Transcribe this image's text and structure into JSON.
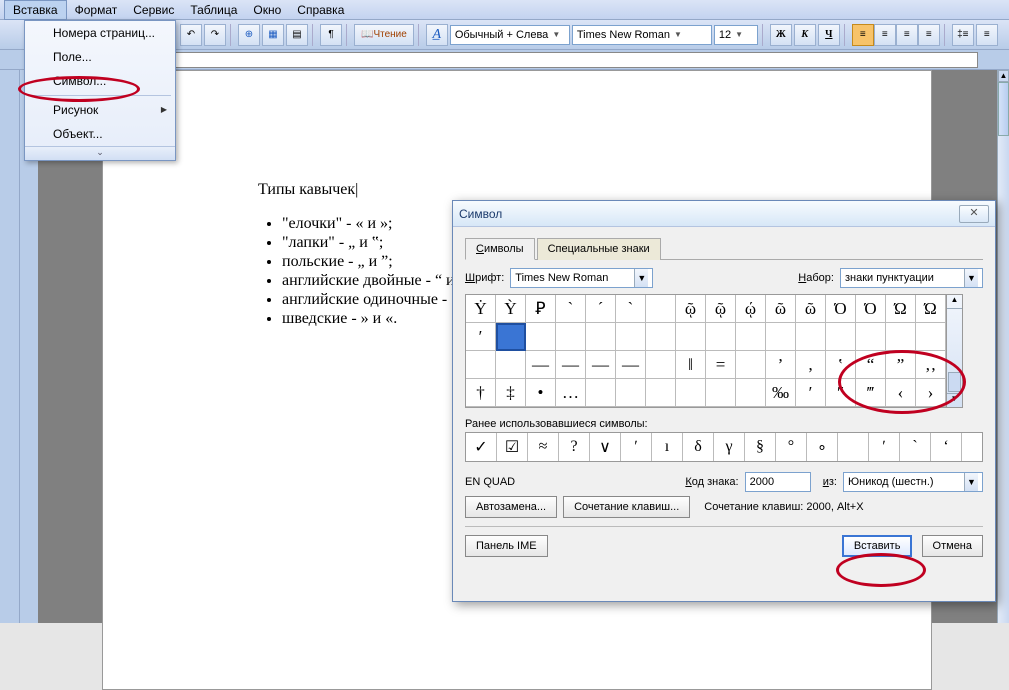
{
  "menubar": [
    "Вставка",
    "Формат",
    "Сервис",
    "Таблица",
    "Окно",
    "Справка"
  ],
  "menubar_u": [
    "В",
    "Ф",
    "С",
    "Т",
    "О",
    "С"
  ],
  "toolbar": {
    "reading": "Чтение",
    "style": "Обычный + Слева",
    "font": "Times New Roman",
    "size": "12",
    "bold": "Ж",
    "italic": "К",
    "under": "Ч"
  },
  "dropdown": {
    "items": [
      {
        "label": "Номера страниц...",
        "u": "Н"
      },
      {
        "label": "Поле...",
        "u": "П"
      },
      {
        "label": "Символ...",
        "u": "С"
      },
      {
        "label": "Рисунок",
        "u": "Р",
        "sub": true
      },
      {
        "label": "Объект...",
        "u": "О"
      }
    ]
  },
  "doc": {
    "heading": "Типы кавычек",
    "items": [
      "\"елочки\" - « и »;",
      "\"лапки\" - „ и ‟;",
      "польские - „ и ”;",
      "английские двойные - “ и ”;",
      "английские одиночные - ‘ и ’;",
      "шведские - » и «."
    ]
  },
  "dialog": {
    "title": "Символ",
    "tabs": [
      "Символы",
      "Специальные знаки"
    ],
    "font_label": "Шрифт:",
    "font_u": "Ш",
    "font_val": "Times New Roman",
    "set_label": "Набор:",
    "set_u": "Н",
    "set_val": "знаки пунктуации",
    "grid": [
      [
        "Ẏ",
        "Ỳ",
        "Ꝑ",
        "ˋ",
        "ˊ",
        "ˋ",
        "",
        "ῷ",
        "ῷ",
        "ῴ",
        "ῶ",
        "ῶ",
        "Ό",
        "Ό",
        "Ώ",
        "Ώ"
      ],
      [
        "ʹ",
        "",
        "",
        "",
        "",
        "",
        "",
        "",
        "",
        "",
        "",
        "",
        "",
        "",
        "",
        ""
      ],
      [
        "",
        "",
        "—",
        "—",
        "—",
        "—",
        "",
        "‖",
        "=",
        "",
        "’",
        "‚",
        "‛",
        "“",
        "”",
        "‚‚"
      ],
      [
        "†",
        "‡",
        "•",
        "…",
        "",
        "",
        "",
        "",
        "",
        "",
        "‰",
        "′",
        "″",
        "‴",
        "‹",
        "›"
      ]
    ],
    "selected_row": 1,
    "selected_col": 1,
    "recent_label": "Ранее использовавшиеся символы:",
    "recent": [
      "✓",
      "☑",
      "≈",
      "?",
      "∨",
      "ʹ",
      "ı",
      "δ",
      "γ",
      "§",
      "°",
      "∘",
      "",
      "ʹ",
      "`",
      "ʻ"
    ],
    "char_name": "EN QUAD",
    "code_label": "Код знака:",
    "code_u": "К",
    "code_val": "2000",
    "from_label": "из:",
    "from_u": "и",
    "from_val": "Юникод (шестн.)",
    "auto": "Автозамена...",
    "keys": "Сочетание клавиш...",
    "hint": "Сочетание клавиш: 2000, Alt+X",
    "ime": "Панель IME",
    "insert": "Вставить",
    "cancel": "Отмена"
  }
}
